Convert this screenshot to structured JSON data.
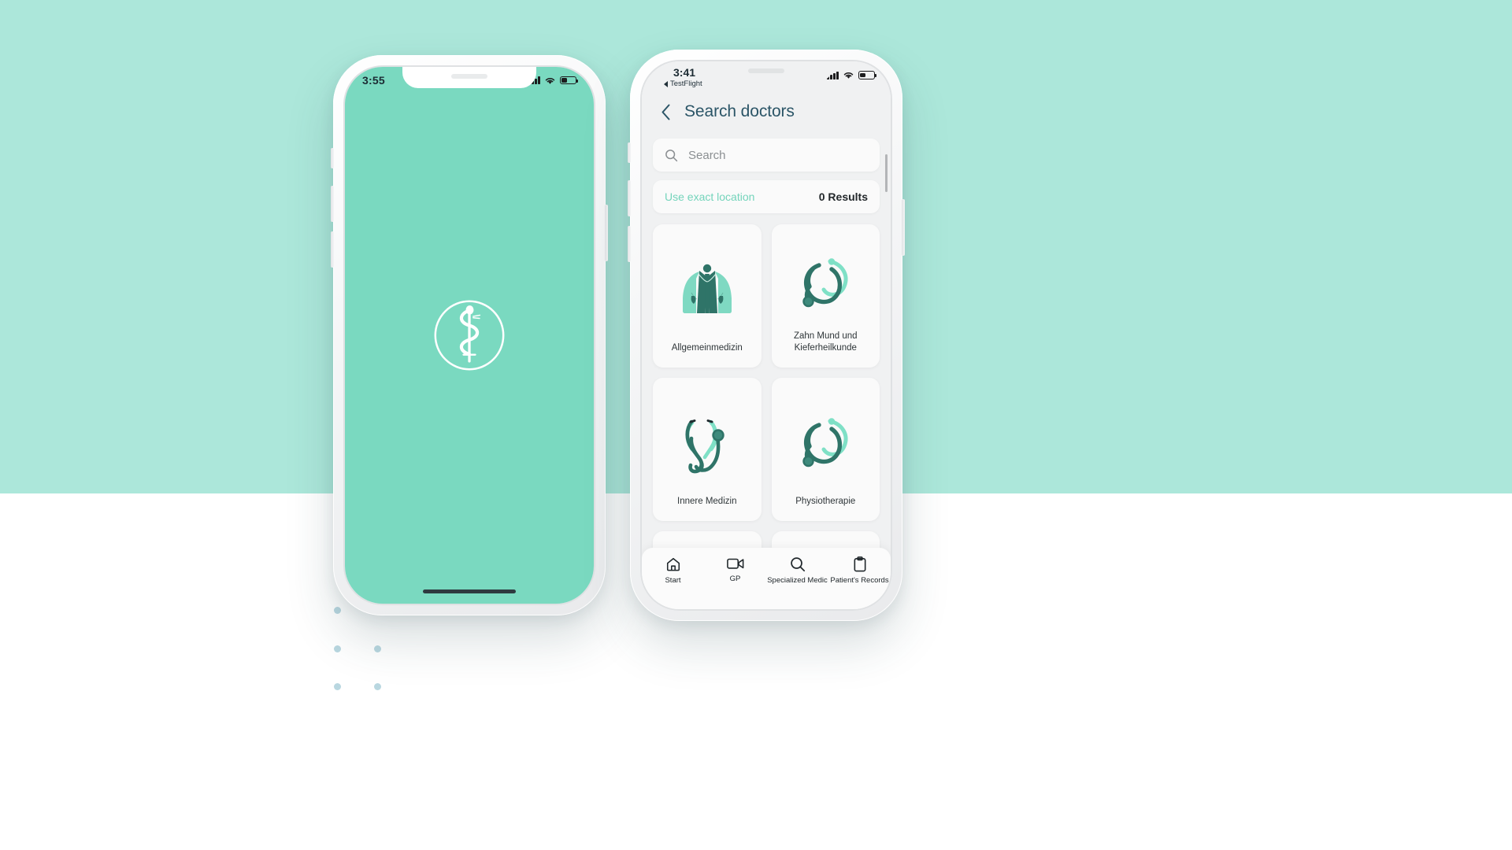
{
  "theme": {
    "background_mint": "#ace7da",
    "background_white": "#ffffff",
    "splash_mint": "#7ad9c0",
    "accent_teal": "#74d4bb",
    "dark_teal": "#2f7468",
    "title_blue": "#2b5567",
    "dot_color": "#b9d7e0"
  },
  "phone_left": {
    "status": {
      "time": "3:55",
      "signal_icon": "cellular-signal-icon",
      "wifi_icon": "wifi-icon",
      "battery_icon": "battery-icon"
    },
    "splash": {
      "logo_icon": "rod-of-asclepius-logo"
    },
    "home_indicator": "home-indicator"
  },
  "phone_right": {
    "status": {
      "time": "3:41",
      "back_app_label": "TestFlight",
      "signal_icon": "cellular-signal-icon",
      "wifi_icon": "wifi-icon",
      "battery_icon": "battery-icon"
    },
    "navbar": {
      "back_icon": "chevron-left-icon",
      "title": "Search doctors"
    },
    "search": {
      "icon": "search-icon",
      "placeholder": "Search",
      "value": ""
    },
    "location_row": {
      "label": "Use exact location",
      "results": "0 Results"
    },
    "specialties": [
      {
        "label": "Allgemeinmedizin",
        "icon": "lab-coat-icon"
      },
      {
        "label": "Zahn Mund und Kieferheilkunde",
        "icon": "stethoscope-double-icon"
      },
      {
        "label": "Innere Medizin",
        "icon": "stethoscope-icon"
      },
      {
        "label": "Physiotherapie",
        "icon": "stethoscope-double-icon"
      },
      {
        "label": "",
        "icon": "stethoscope-arc-icon"
      },
      {
        "label": "",
        "icon": "microscope-icon"
      }
    ],
    "tabbar": [
      {
        "label": "Start",
        "icon": "home-icon",
        "active": false
      },
      {
        "label": "GP",
        "icon": "video-camera-icon",
        "active": false
      },
      {
        "label": "Specialized Medic",
        "icon": "search-icon",
        "active": true
      },
      {
        "label": "Patient's Records",
        "icon": "clipboard-icon",
        "active": false
      }
    ],
    "scrollbar": "vertical-scrollbar"
  }
}
